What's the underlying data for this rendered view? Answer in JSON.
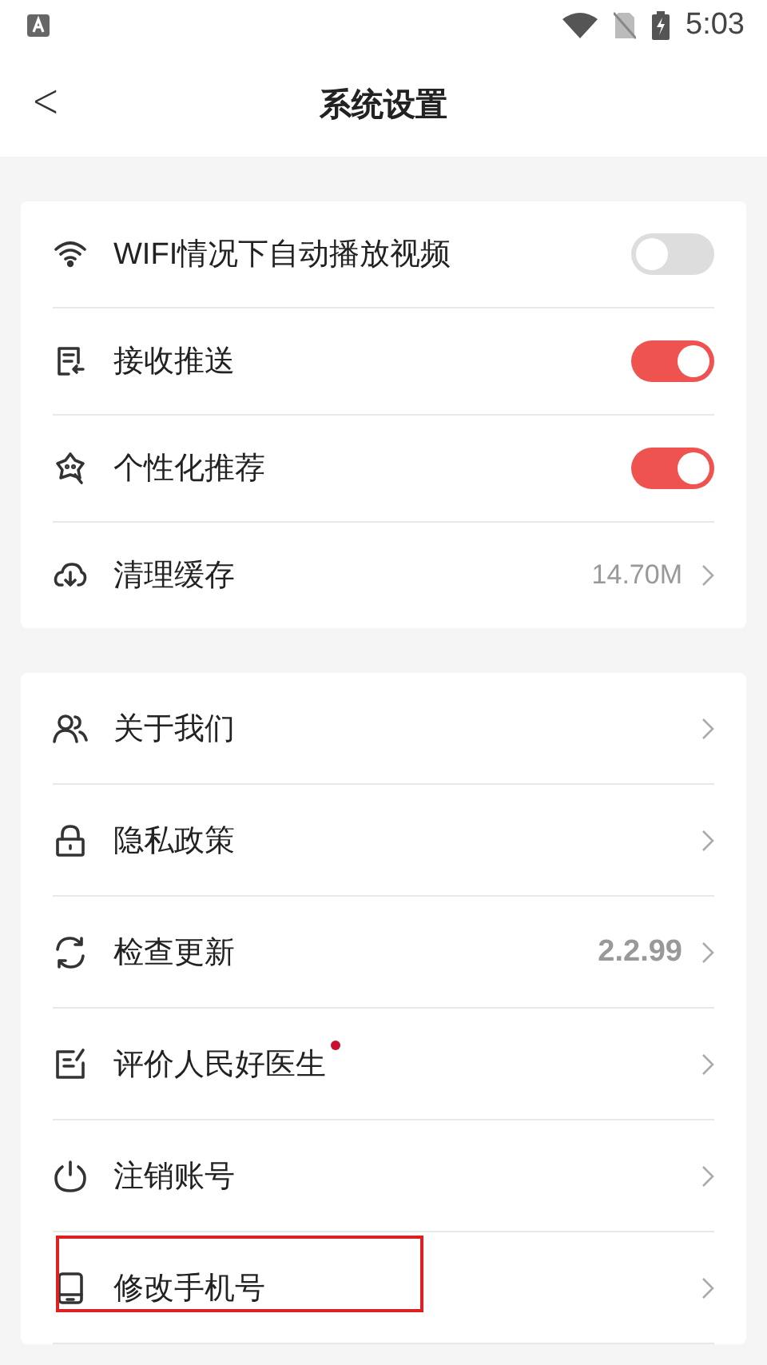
{
  "status_bar": {
    "time": "5:03"
  },
  "header": {
    "back": "<",
    "title": "系统设置"
  },
  "sections": [
    {
      "items": [
        {
          "kind": "toggle",
          "label": "WIFI情况下自动播放视频",
          "on": false
        },
        {
          "kind": "toggle",
          "label": "接收推送",
          "on": true
        },
        {
          "kind": "toggle",
          "label": "个性化推荐",
          "on": true
        },
        {
          "kind": "link",
          "label": "清理缓存",
          "value": "14.70M",
          "dot": false,
          "highlighted": false
        }
      ]
    },
    {
      "items": [
        {
          "kind": "link",
          "label": "关于我们",
          "dot": false,
          "highlighted": false
        },
        {
          "kind": "link",
          "label": "隐私政策",
          "dot": false,
          "highlighted": false
        },
        {
          "kind": "link",
          "label": "检查更新",
          "value": "2.2.99",
          "dot": false,
          "highlighted": false
        },
        {
          "kind": "link",
          "label": "评价人民好医生",
          "dot": true,
          "highlighted": false
        },
        {
          "kind": "link",
          "label": "注销账号",
          "dot": false,
          "highlighted": false
        },
        {
          "kind": "link",
          "label": "修改手机号",
          "dot": false,
          "highlighted": true
        }
      ]
    }
  ]
}
